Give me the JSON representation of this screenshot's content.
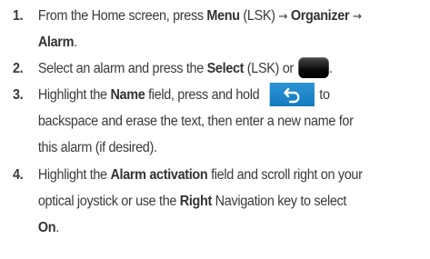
{
  "steps": [
    {
      "number": "1.",
      "lines": [
        [
          "From the Home screen, press ",
          "Menu",
          " (LSK) ",
          "→",
          " ",
          "Organizer",
          " ",
          "→"
        ],
        [
          "Alarm",
          "."
        ]
      ]
    },
    {
      "number": "2.",
      "lines": [
        [
          "Select an alarm and press the ",
          "Select",
          " (LSK) or ",
          "."
        ]
      ],
      "key_icon": "select-key-icon"
    },
    {
      "number": "3.",
      "lines": [
        [
          "Highlight the ",
          "Name",
          " field, press and hold ",
          "to"
        ],
        [
          "backspace and erase the text, then enter a new name for"
        ],
        [
          "this alarm (if desired)."
        ]
      ],
      "key_icon": "back-key-icon"
    },
    {
      "number": "4.",
      "lines": [
        [
          "Highlight the ",
          "Alarm activation",
          " field and scroll right on your"
        ],
        [
          "optical joystick or use the ",
          "Right",
          " Navigation key to select"
        ],
        [
          "On",
          "."
        ]
      ]
    }
  ],
  "colors": {
    "text": "#3a3a3a",
    "back_key": "#1f88c8",
    "select_key": "#111111"
  }
}
